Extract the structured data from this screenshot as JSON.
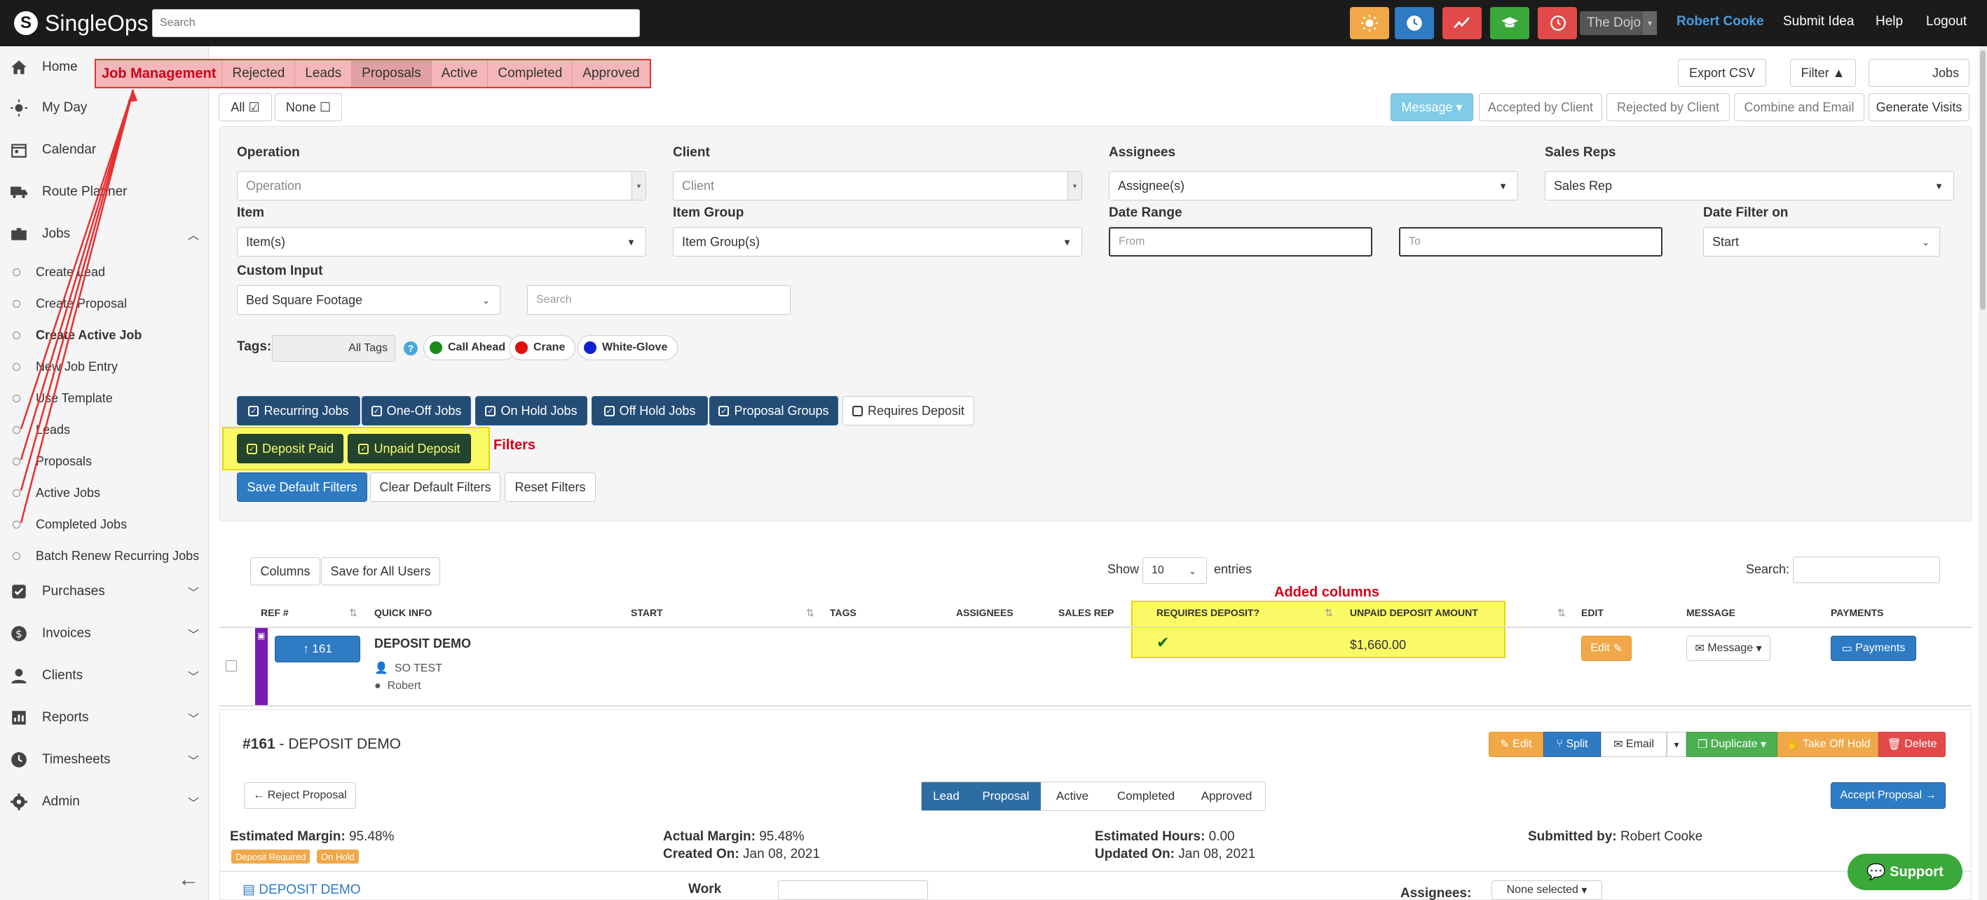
{
  "brand": "SingleOps",
  "header": {
    "search_placeholder": "Search",
    "org": "The Dojo",
    "user": "Robert Cooke",
    "links": [
      "Submit Idea",
      "Help",
      "Logout"
    ],
    "icon_buttons": [
      {
        "name": "weather-icon",
        "color": "#f0a848"
      },
      {
        "name": "clock-icon",
        "color": "#2e7bc4"
      },
      {
        "name": "trend-icon",
        "color": "#e24a4a"
      },
      {
        "name": "graduation-icon",
        "color": "#3aa83a"
      },
      {
        "name": "history-icon",
        "color": "#e24a4a"
      }
    ]
  },
  "sidebar": {
    "items": [
      {
        "label": "Home",
        "icon": "home-icon"
      },
      {
        "label": "My Day",
        "icon": "sun-icon"
      },
      {
        "label": "Calendar",
        "icon": "calendar-icon"
      },
      {
        "label": "Route Planner",
        "icon": "truck-icon"
      },
      {
        "label": "Jobs",
        "icon": "briefcase-icon"
      }
    ],
    "job_sub_items": [
      "Create Lead",
      "Create Proposal",
      "Create Active Job",
      "New Job Entry",
      "Use Template",
      "Leads",
      "Proposals",
      "Active Jobs",
      "Completed Jobs",
      "Batch Renew Recurring Jobs"
    ],
    "lower_items": [
      {
        "label": "Purchases",
        "icon": "check-square-icon"
      },
      {
        "label": "Invoices",
        "icon": "dollar-icon"
      },
      {
        "label": "Clients",
        "icon": "user-icon"
      },
      {
        "label": "Reports",
        "icon": "chart-icon"
      },
      {
        "label": "Timesheets",
        "icon": "clock-icon"
      },
      {
        "label": "Admin",
        "icon": "gear-icon"
      }
    ]
  },
  "tabs": {
    "section_label": "Job Management",
    "items": [
      "Rejected",
      "Leads",
      "Proposals",
      "Active",
      "Completed",
      "Approved"
    ],
    "active": "Proposals"
  },
  "toolbar": {
    "all": "All",
    "none": "None",
    "export_csv": "Export CSV",
    "filter": "Filter",
    "jobs": "Jobs",
    "message": "Message",
    "accepted_by_client": "Accepted by Client",
    "rejected_by_client": "Rejected by Client",
    "combine_and_email": "Combine and Email",
    "generate_visits": "Generate Visits"
  },
  "filters": {
    "operation_label": "Operation",
    "operation_placeholder": "Operation",
    "client_label": "Client",
    "client_placeholder": "Client",
    "assignees_label": "Assignees",
    "assignees_value": "Assignee(s)",
    "sales_reps_label": "Sales Reps",
    "sales_reps_value": "Sales Rep",
    "item_label": "Item",
    "item_value": "Item(s)",
    "item_group_label": "Item Group",
    "item_group_value": "Item Group(s)",
    "date_range_label": "Date Range",
    "from_placeholder": "From",
    "to_placeholder": "To",
    "date_filter_label": "Date Filter on",
    "date_filter_value": "Start",
    "custom_input_label": "Custom Input",
    "custom_input_value": "Bed Square Footage",
    "custom_search_placeholder": "Search",
    "tags_label": "Tags:",
    "all_tags": "All Tags",
    "tags": [
      {
        "label": "Call Ahead",
        "color": "#1a8a1a"
      },
      {
        "label": "Crane",
        "color": "#e01010"
      },
      {
        "label": "White-Glove",
        "color": "#1020d0"
      }
    ],
    "job_type_buttons": [
      "Recurring Jobs",
      "One-Off Jobs",
      "On Hold Jobs",
      "Off Hold Jobs",
      "Proposal Groups"
    ],
    "requires_deposit": "Requires Deposit",
    "deposit_paid": "Deposit Paid",
    "unpaid_deposit": "Unpaid Deposit",
    "annotation": "Filters",
    "save_default": "Save Default Filters",
    "clear_default": "Clear Default Filters",
    "reset": "Reset Filters"
  },
  "table": {
    "columns_btn": "Columns",
    "save_all_users": "Save for All Users",
    "show": "Show",
    "entries_value": "10",
    "entries": "entries",
    "search_label": "Search:",
    "annotation": "Added columns",
    "headers": [
      "REF #",
      "QUICK INFO",
      "START",
      "TAGS",
      "ASSIGNEES",
      "SALES REP",
      "REQUIRES DEPOSIT?",
      "UNPAID DEPOSIT AMOUNT",
      "EDIT",
      "MESSAGE",
      "PAYMENTS"
    ],
    "row": {
      "ref": "161",
      "title": "DEPOSIT DEMO",
      "client": "SO TEST",
      "person": "Robert",
      "requires_deposit": "✔",
      "unpaid_amount": "$1,660.00",
      "edit": "Edit",
      "message": "Message",
      "payments": "Payments"
    }
  },
  "detail": {
    "ref": "#161",
    "title": " - DEPOSIT DEMO",
    "actions": [
      "Edit",
      "Split",
      "Email",
      "Duplicate",
      "Take Off Hold",
      "Delete"
    ],
    "reject": "Reject Proposal",
    "stages": [
      "Lead",
      "Proposal",
      "Active",
      "Completed",
      "Approved"
    ],
    "accept": "Accept Proposal",
    "estimated_margin_label": "Estimated Margin:",
    "estimated_margin": "95.48%",
    "actual_margin_label": "Actual Margin:",
    "actual_margin": "95.48%",
    "created_label": "Created On:",
    "created": "Jan 08, 2021",
    "estimated_hours_label": "Estimated Hours:",
    "estimated_hours": "0.00",
    "updated_label": "Updated On:",
    "updated": "Jan 08, 2021",
    "submitted_label": "Submitted by:",
    "submitted": "Robert Cooke",
    "badges": [
      "Deposit Required",
      "On Hold"
    ],
    "job_link": "DEPOSIT DEMO",
    "work_label": "Work",
    "assignees_label": "Assignees:",
    "assignees_value": "None selected"
  },
  "support": "Support"
}
